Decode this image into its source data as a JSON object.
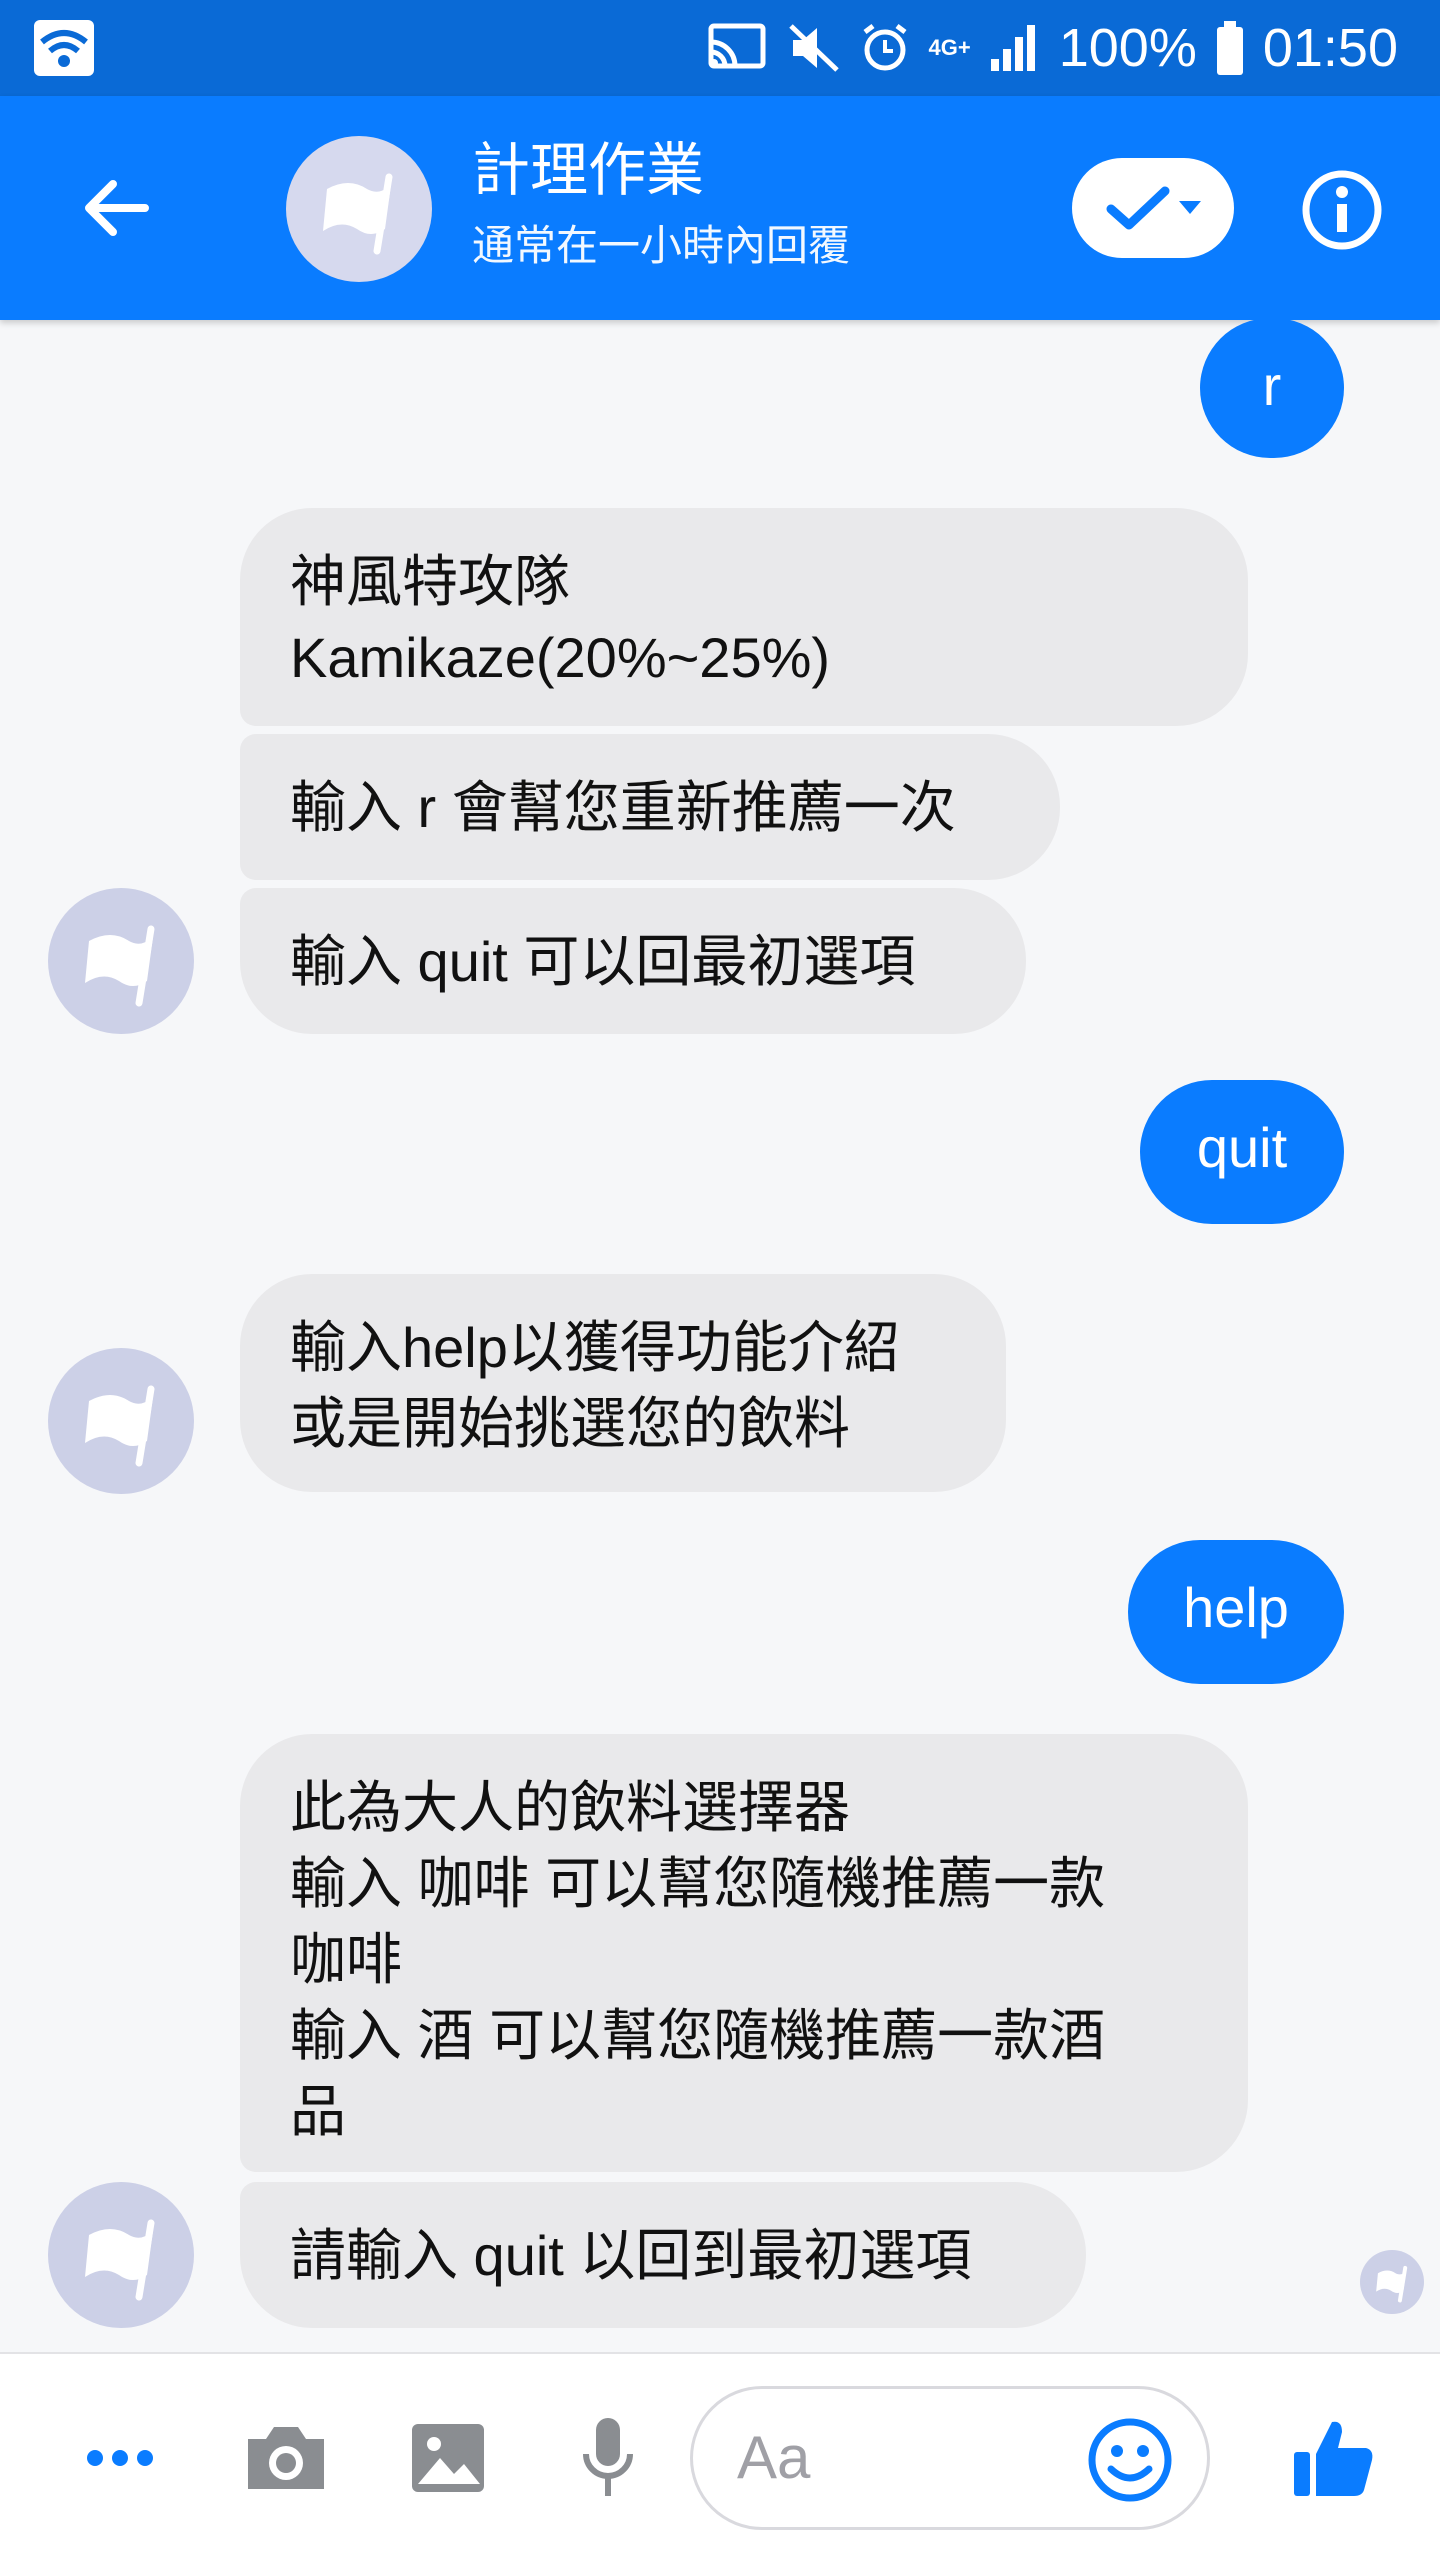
{
  "status_bar": {
    "battery": "100%",
    "time": "01:50",
    "network": "4G+"
  },
  "header": {
    "title": "計理作業",
    "subtitle": "通常在一小時內回覆"
  },
  "messages": [
    {
      "from": "me",
      "text": "r"
    },
    {
      "from": "bot",
      "text": "神風特攻隊\nKamikaze(20%~25%)"
    },
    {
      "from": "bot",
      "text": "輸入 r 會幫您重新推薦一次"
    },
    {
      "from": "bot",
      "text": "輸入 quit 可以回最初選項"
    },
    {
      "from": "me",
      "text": "quit"
    },
    {
      "from": "bot",
      "text": "輸入help以獲得功能介紹\n或是開始挑選您的飲料"
    },
    {
      "from": "me",
      "text": "help"
    },
    {
      "from": "bot",
      "text": "此為大人的飲料選擇器\n輸入 咖啡 可以幫您隨機推薦一款\n咖啡\n輸入 酒 可以幫您隨機推薦一款酒\n品"
    },
    {
      "from": "bot",
      "text": "請輸入 quit 以回到最初選項"
    }
  ],
  "composer": {
    "placeholder": "Aa"
  },
  "colors": {
    "accent": "#0a7cff",
    "status_bar": "#0a6ad6",
    "bubble_in": "#e9e9eb"
  }
}
